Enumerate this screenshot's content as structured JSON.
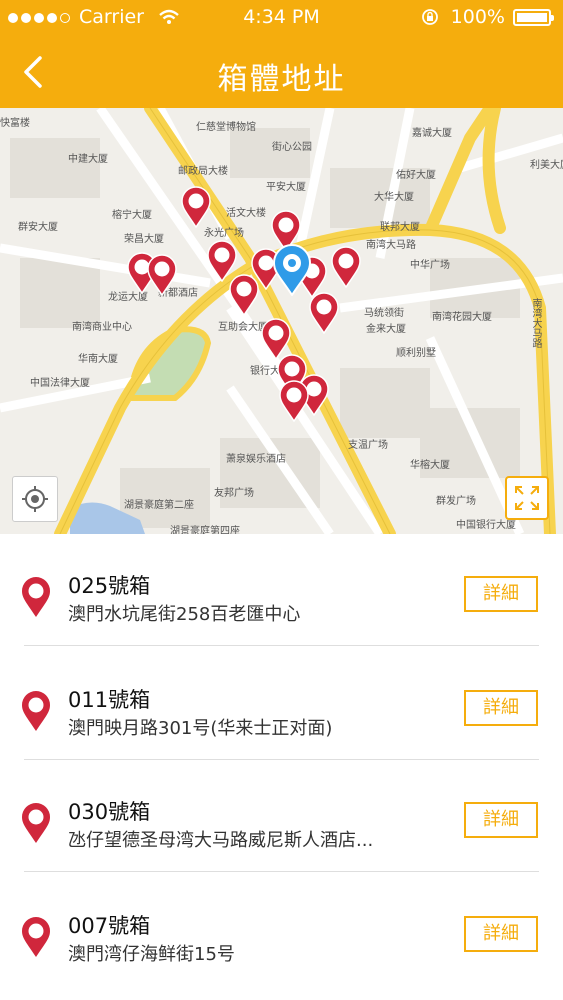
{
  "status_bar": {
    "carrier": "Carrier",
    "time": "4:34 PM",
    "battery": "100%",
    "wifi_icon": "wifi-icon",
    "lock_icon": "orientation-lock-icon"
  },
  "header": {
    "title": "箱體地址",
    "back_icon": "chevron-left-icon"
  },
  "colors": {
    "accent": "#f5ad0d",
    "pin": "#d0273c",
    "current_location": "#2f9be8"
  },
  "map": {
    "labels": [
      "快富楼",
      "仁慈堂博物馆",
      "街心公园",
      "嘉诚大厦",
      "中建大厦",
      "邮政局大楼",
      "佑好大厦",
      "利美大厦",
      "群安大厦",
      "榕宁大厦",
      "平安大厦",
      "大华大厦",
      "荣昌大厦",
      "活文大楼",
      "永光广场",
      "联邦大厦",
      "南湾大马路",
      "中华广场",
      "龙运大厦",
      "新都酒店",
      "南湾商业中心",
      "互助会大厦",
      "马统领街",
      "南湾花园大厦",
      "华南大厦",
      "金来大厦",
      "中国法律大厦",
      "银行大厦",
      "顺利别墅",
      "支温广场",
      "华榕大厦",
      "萧泉娱乐酒店",
      "友邦广场",
      "群发广场",
      "中国银行大厦",
      "湖景豪庭第二座",
      "湖景豪庭第四座",
      "南湾大马路"
    ],
    "locate_icon": "crosshair-icon",
    "fullscreen_icon": "fullscreen-icon"
  },
  "boxes": [
    {
      "name": "025號箱",
      "address": "澳門水坑尾街258百老匯中心",
      "button": "詳細"
    },
    {
      "name": "011號箱",
      "address": "澳門映月路301号(华来士正对面)",
      "button": "詳細"
    },
    {
      "name": "030號箱",
      "address": "氹仔望德圣母湾大马路威尼斯人酒店...",
      "button": "詳細"
    },
    {
      "name": "007號箱",
      "address": "澳門湾仔海鲜街15号",
      "button": "詳細"
    }
  ]
}
